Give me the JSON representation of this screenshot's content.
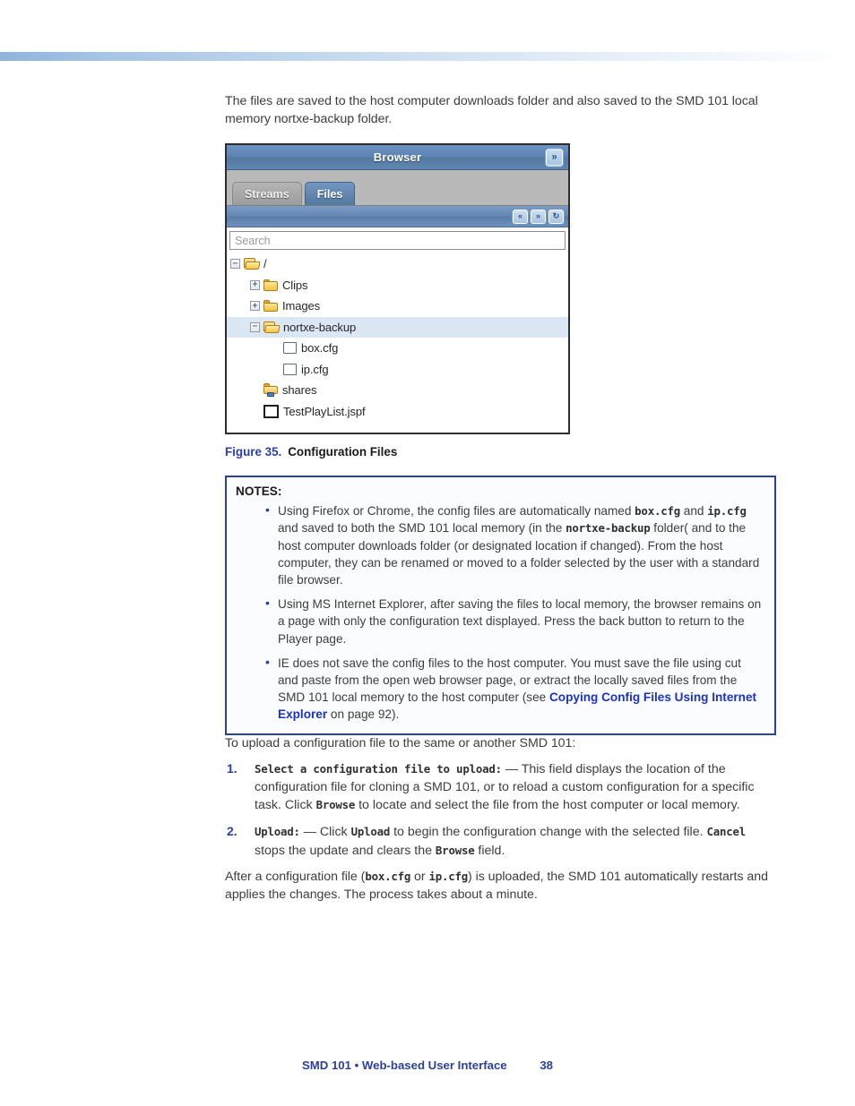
{
  "intro_paragraph": "The files are saved to the host computer downloads folder and also saved to the SMD 101 local memory nortxe-backup folder.",
  "browser_panel": {
    "title": "Browser",
    "expand_button_icon": "double-chevron-right-icon",
    "tabs": [
      {
        "label": "Streams",
        "active": false
      },
      {
        "label": "Files",
        "active": true
      }
    ],
    "toolbar_buttons": [
      {
        "name": "collapse-all-button",
        "glyph": "«"
      },
      {
        "name": "expand-all-button",
        "glyph": "»"
      },
      {
        "name": "refresh-button",
        "glyph": "↻"
      }
    ],
    "search": {
      "placeholder": "Search",
      "value": ""
    },
    "tree": [
      {
        "label": "/",
        "indent": 0,
        "expander": "minus",
        "icon": "folder-open",
        "selected": false
      },
      {
        "label": "Clips",
        "indent": 1,
        "expander": "plus",
        "icon": "folder-closed",
        "selected": false
      },
      {
        "label": "Images",
        "indent": 1,
        "expander": "plus",
        "icon": "folder-closed",
        "selected": false
      },
      {
        "label": "nortxe-backup",
        "indent": 1,
        "expander": "minus",
        "icon": "folder-open",
        "selected": true
      },
      {
        "label": "box.cfg",
        "indent": 2,
        "expander": "none",
        "icon": "cfg-file",
        "selected": false
      },
      {
        "label": "ip.cfg",
        "indent": 2,
        "expander": "none",
        "icon": "cfg-file",
        "selected": false
      },
      {
        "label": "shares",
        "indent": 1,
        "expander": "none",
        "icon": "folder-share",
        "selected": false
      },
      {
        "label": "TestPlayList.jspf",
        "indent": 1,
        "expander": "none",
        "icon": "playlist-file",
        "selected": false
      }
    ]
  },
  "figure": {
    "number": "Figure 35.",
    "caption": "Configuration Files"
  },
  "notes": {
    "title": "NOTES:",
    "items": [
      {
        "segments": [
          {
            "text": "Using Firefox or Chrome, the config files are automatically named ",
            "style": "normal"
          },
          {
            "text": "box.cfg",
            "style": "mono"
          },
          {
            "text": " and ",
            "style": "normal"
          },
          {
            "text": "ip.cfg",
            "style": "mono"
          },
          {
            "text": " and saved to both the SMD 101 local memory (in the ",
            "style": "normal"
          },
          {
            "text": "nortxe-backup",
            "style": "mono"
          },
          {
            "text": " folder( and to the host computer downloads folder (or designated location if changed). From the host computer, they can be renamed or moved to a folder selected by the user with a standard file browser.",
            "style": "normal"
          }
        ]
      },
      {
        "segments": [
          {
            "text": "Using MS Internet Explorer, after saving the files to local memory, the browser remains on a page with only the configuration text displayed. Press the back button to return to the Player page.",
            "style": "normal"
          }
        ]
      },
      {
        "segments": [
          {
            "text": "IE does not save the config files to the host computer. You must save the file using cut and paste from the open web browser page, or extract the locally saved files from the SMD 101 local memory to the host computer (see ",
            "style": "normal"
          },
          {
            "text": "Copying Config Files Using Internet Explorer",
            "style": "link"
          },
          {
            "text": " on page 92).",
            "style": "normal"
          }
        ]
      }
    ]
  },
  "upload_section": {
    "lead": "To upload a configuration file to the same or another SMD 101:",
    "steps": [
      {
        "number": "1.",
        "segments": [
          {
            "text": "Select a configuration file to upload:",
            "style": "mono"
          },
          {
            "text": " — This field displays the location of the configuration file for cloning a SMD 101, or to reload a custom configuration for a specific task. Click ",
            "style": "normal"
          },
          {
            "text": "Browse",
            "style": "mono"
          },
          {
            "text": " to locate and select the file from the host computer or local memory.",
            "style": "normal"
          }
        ]
      },
      {
        "number": "2.",
        "segments": [
          {
            "text": "Upload:",
            "style": "mono"
          },
          {
            "text": " — Click ",
            "style": "normal"
          },
          {
            "text": "Upload",
            "style": "mono"
          },
          {
            "text": " to begin the configuration change with the selected file. ",
            "style": "normal"
          },
          {
            "text": "Cancel",
            "style": "mono"
          },
          {
            "text": " stops the update and clears the ",
            "style": "normal"
          },
          {
            "text": "Browse",
            "style": "mono"
          },
          {
            "text": " field.",
            "style": "normal"
          }
        ]
      }
    ],
    "closing": {
      "segments": [
        {
          "text": "After a configuration file (",
          "style": "normal"
        },
        {
          "text": "box.cfg",
          "style": "mono"
        },
        {
          "text": " or ",
          "style": "normal"
        },
        {
          "text": "ip.cfg",
          "style": "mono"
        },
        {
          "text": ") is uploaded, the SMD 101 automatically restarts and applies the changes. The process takes about a minute.",
          "style": "normal"
        }
      ]
    }
  },
  "footer": {
    "text": "SMD 101 • Web-based User Interface",
    "page_number": "38"
  },
  "colors": {
    "accent_blue": "#2b3f9e",
    "link_blue": "#1b32c8",
    "panel_blue": "#5c83b4",
    "selected_row": "#dbe7f5",
    "folder_yellow": "#f5c646"
  }
}
